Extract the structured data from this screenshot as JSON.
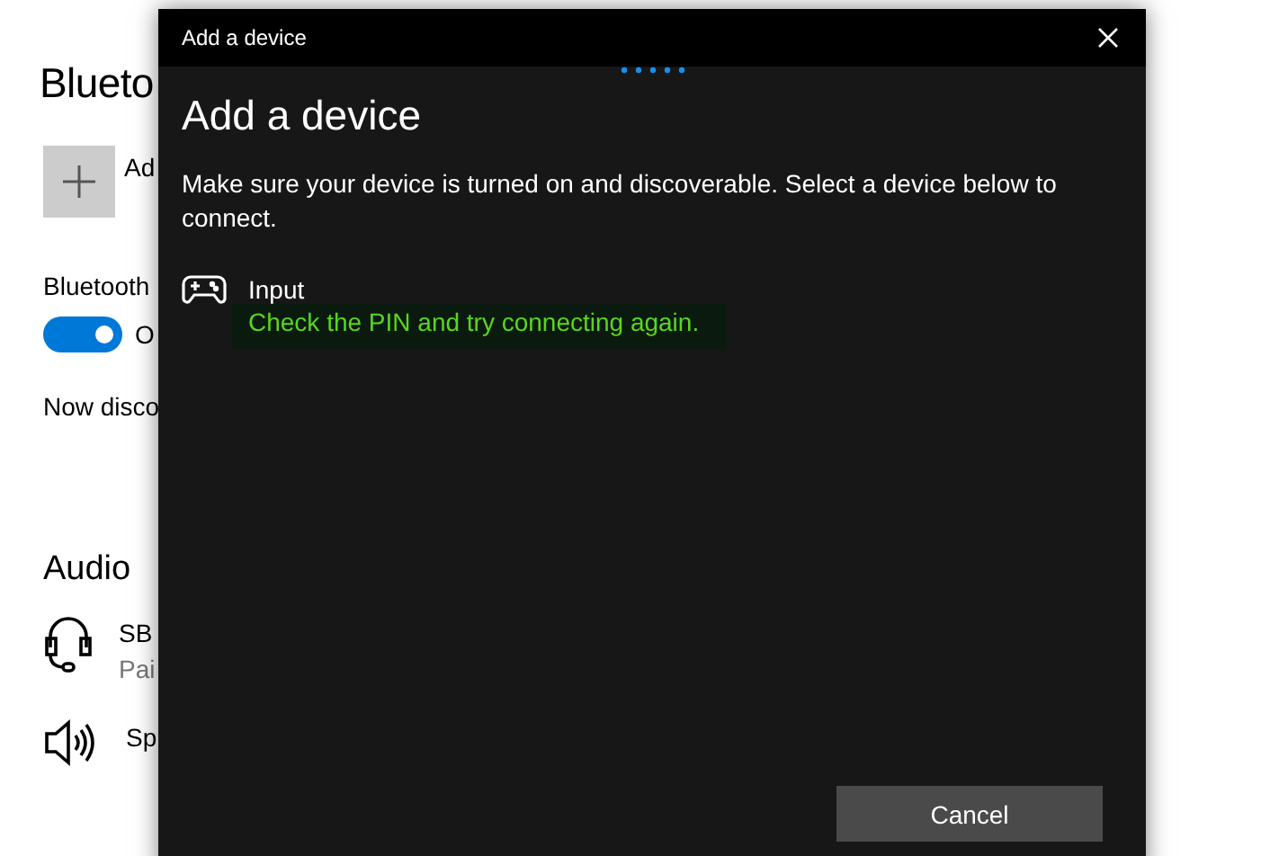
{
  "settings": {
    "title": "Blueto",
    "add_label": "Ad",
    "bluetooth_label": "Bluetooth",
    "toggle": {
      "on": true,
      "label": "O"
    },
    "status": "Now disco",
    "audio_heading": "Audio",
    "devices": [
      {
        "kind": "headset",
        "name": "SB",
        "status": "Pai"
      },
      {
        "kind": "speaker",
        "name": "Sp"
      }
    ]
  },
  "dialog": {
    "title": "Add a device",
    "heading": "Add a device",
    "description": "Make sure your device is turned on and discoverable. Select a device below to connect.",
    "devices": [
      {
        "kind": "gamepad",
        "name": "Input",
        "message": "Check the PIN and try connecting again."
      }
    ],
    "buttons": [
      "Cancel"
    ]
  }
}
